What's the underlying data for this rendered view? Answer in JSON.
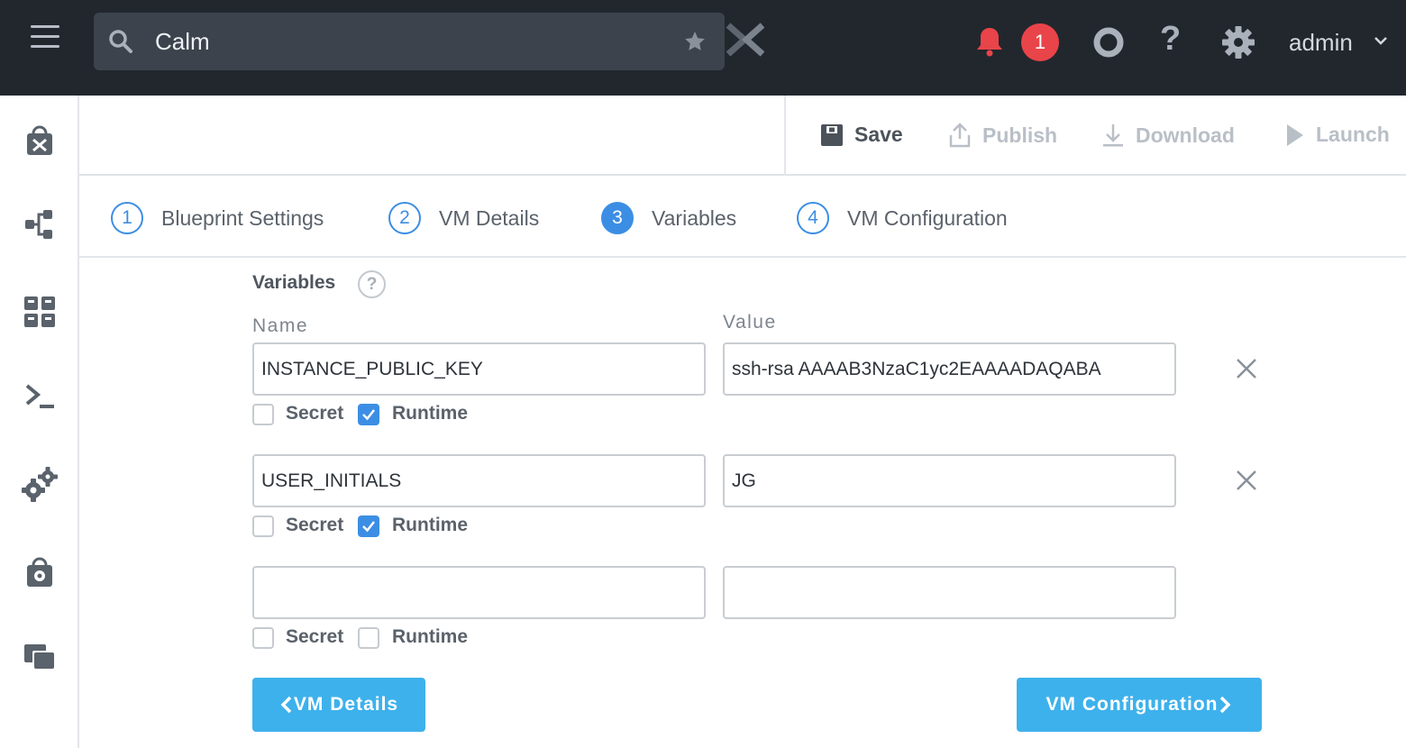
{
  "header": {
    "search_value": "Calm",
    "notification_count": "1",
    "help_label": "?",
    "user": "admin"
  },
  "sidebar": {
    "icons": [
      "marketplace-icon",
      "blueprints-icon",
      "apps-icon",
      "runbooks-icon",
      "settings-icon",
      "marketplace-manager-icon",
      "projects-icon"
    ]
  },
  "toolbar": {
    "save": "Save",
    "publish": "Publish",
    "download": "Download",
    "launch": "Launch"
  },
  "steps": [
    {
      "num": "1",
      "label": "Blueprint Settings"
    },
    {
      "num": "2",
      "label": "VM Details"
    },
    {
      "num": "3",
      "label": "Variables"
    },
    {
      "num": "4",
      "label": "VM Configuration"
    }
  ],
  "variables": {
    "title": "Variables",
    "help": "?",
    "name_header": "Name",
    "value_header": "Value",
    "secret_label": "Secret",
    "runtime_label": "Runtime",
    "rows": [
      {
        "name": "INSTANCE_PUBLIC_KEY",
        "value": "ssh-rsa AAAAB3NzaC1yc2EAAAADAQABA",
        "secret": false,
        "runtime": true
      },
      {
        "name": "USER_INITIALS",
        "value": "JG",
        "secret": false,
        "runtime": true
      },
      {
        "name": "",
        "value": "",
        "secret": false,
        "runtime": false
      }
    ]
  },
  "nav": {
    "prev": "VM Details",
    "next": "VM Configuration"
  },
  "colors": {
    "topbar": "#22272e",
    "accent": "#3c8ee4",
    "button": "#3db1ec",
    "notification": "#e9444a"
  }
}
